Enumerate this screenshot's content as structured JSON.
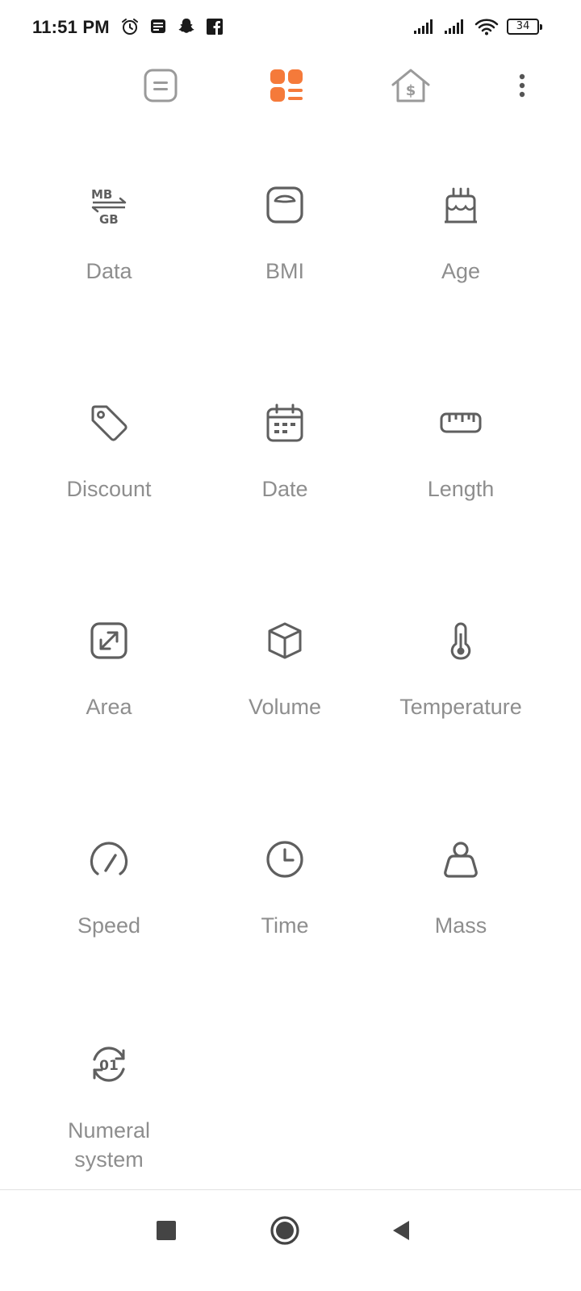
{
  "status_bar": {
    "time": "11:51 PM",
    "battery_level": "34",
    "left_icons": [
      "alarm-icon",
      "news-icon",
      "snapchat-icon",
      "facebook-icon"
    ],
    "right_icons": [
      "signal-sim1-icon",
      "signal-sim2-icon",
      "wifi-icon",
      "battery-icon"
    ]
  },
  "toolbar": {
    "tabs": [
      {
        "icon": "calculator-tab-icon",
        "active": false
      },
      {
        "icon": "converter-tab-icon",
        "active": true
      },
      {
        "icon": "finance-tab-icon",
        "active": false
      }
    ],
    "more_icon": "more-vertical-icon"
  },
  "converters": [
    {
      "label": "Data",
      "icon": "mb-gb-icon"
    },
    {
      "label": "BMI",
      "icon": "scale-icon"
    },
    {
      "label": "Age",
      "icon": "cake-icon"
    },
    {
      "label": "Discount",
      "icon": "tag-icon"
    },
    {
      "label": "Date",
      "icon": "calendar-icon"
    },
    {
      "label": "Length",
      "icon": "ruler-icon"
    },
    {
      "label": "Area",
      "icon": "expand-icon"
    },
    {
      "label": "Volume",
      "icon": "cube-icon"
    },
    {
      "label": "Temperature",
      "icon": "thermometer-icon"
    },
    {
      "label": "Speed",
      "icon": "speedometer-icon"
    },
    {
      "label": "Time",
      "icon": "clock-icon"
    },
    {
      "label": "Mass",
      "icon": "weight-icon"
    },
    {
      "label": "Numeral\nsystem",
      "icon": "numeral-system-icon"
    }
  ],
  "colors": {
    "accent": "#f57a3a",
    "icon_gray": "#5f5f5f",
    "label_gray": "#8e8e8e",
    "inactive_tab": "#9a9a9a"
  }
}
